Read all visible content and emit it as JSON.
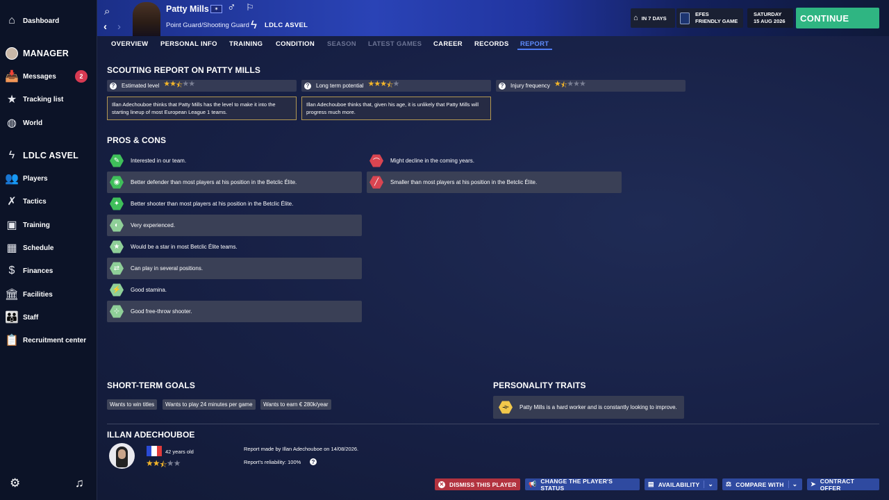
{
  "sidebar": {
    "dashboard": "Dashboard",
    "manager_heading": "MANAGER",
    "messages": "Messages",
    "messages_badge": "2",
    "tracking": "Tracking list",
    "world": "World",
    "club_heading": "LDLC ASVEL",
    "players": "Players",
    "tactics": "Tactics",
    "training": "Training",
    "schedule": "Schedule",
    "finances": "Finances",
    "facilities": "Facilities",
    "staff": "Staff",
    "recruitment": "Recruitment center"
  },
  "header": {
    "player_name": "Patty Mills",
    "position": "Point Guard/Shooting Guard",
    "club": "LDLC ASVEL",
    "next_in": "IN 7 DAYS",
    "next_match_line1": "EFES",
    "next_match_line2": "FRIENDLY GAME",
    "day": "SATURDAY",
    "date": "15 AUG 2026",
    "continue": "CONTINUE"
  },
  "tabs": [
    "OVERVIEW",
    "PERSONAL INFO",
    "TRAINING",
    "CONDITION",
    "SEASON",
    "LATEST GAMES",
    "CAREER",
    "RECORDS",
    "REPORT"
  ],
  "report": {
    "title": "SCOUTING REPORT ON PATTY MILLS",
    "ratings": [
      {
        "label": "Estimated level",
        "stars": 2.5
      },
      {
        "label": "Long term potential",
        "stars": 3.5
      },
      {
        "label": "Injury frequency",
        "stars": 1.5
      }
    ],
    "level_text": "Illan Adechouboe thinks that Patty Mills has the level to make it into the starting lineup of most European League 1 teams.",
    "potential_text": "Illan Adechouboe thinks that, given his age, it is unlikely that Patty Mills will progress much more."
  },
  "pros_cons": {
    "title": "PROS & CONS",
    "pros": [
      "Interested in our team.",
      "Better defender than most players at his position in the Betclic Élite.",
      "Better shooter than most players at his position in the Betclic Élite.",
      "Very experienced.",
      "Would be a star in most Betclic Élite teams.",
      "Can play in several positions.",
      "Good stamina.",
      "Good free-throw shooter."
    ],
    "cons": [
      "Might decline in the coming years.",
      "Smaller than most players at his position in the Betclic Élite."
    ]
  },
  "goals": {
    "title": "SHORT-TERM GOALS",
    "items": [
      "Wants to win titles",
      "Wants to play 24 minutes per game",
      "Wants to earn € 280k/year"
    ]
  },
  "traits": {
    "title": "PERSONALITY TRAITS",
    "text": "Patty Mills is a hard worker and is constantly looking to improve."
  },
  "scout": {
    "name": "ILLAN ADECHOUBOE",
    "age": "42 years old",
    "stars": 2.5,
    "report_made": "Report made by Illan Adechouboe on 14/08/2026.",
    "reliability": "Report's reliability: 100%"
  },
  "actions": {
    "dismiss": "DISMISS THIS PLAYER",
    "status": "CHANGE THE PLAYER'S STATUS",
    "availability": "AVAILABILITY",
    "compare": "COMPARE WITH",
    "contract": "CONTRACT OFFER"
  },
  "icons": {
    "pro_color": "#3fbf5a",
    "con_color": "#d94551"
  }
}
